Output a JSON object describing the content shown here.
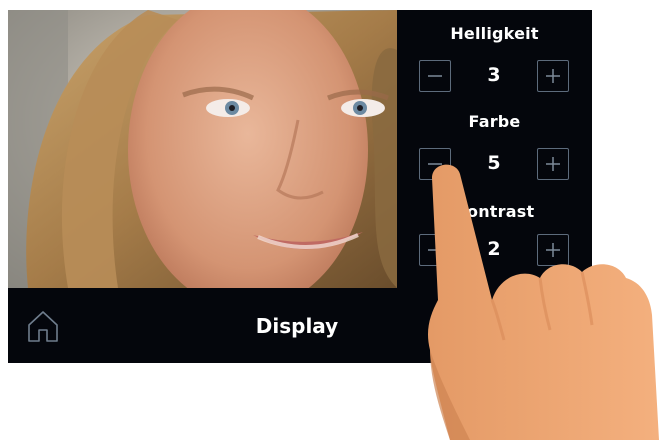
{
  "controls": [
    {
      "label": "Helligkeit",
      "value": "3"
    },
    {
      "label": "Farbe",
      "value": "5"
    },
    {
      "label": "Kontrast",
      "value": "2"
    }
  ],
  "bottom_bar": {
    "title": "Display",
    "home_icon": "home-icon"
  },
  "icons": {
    "minus": "minus-icon",
    "plus": "plus-icon"
  },
  "colors": {
    "panel": "#04060c",
    "button_border": "#5d6b7c",
    "text": "#ffffff",
    "hand": "#f0a772"
  }
}
